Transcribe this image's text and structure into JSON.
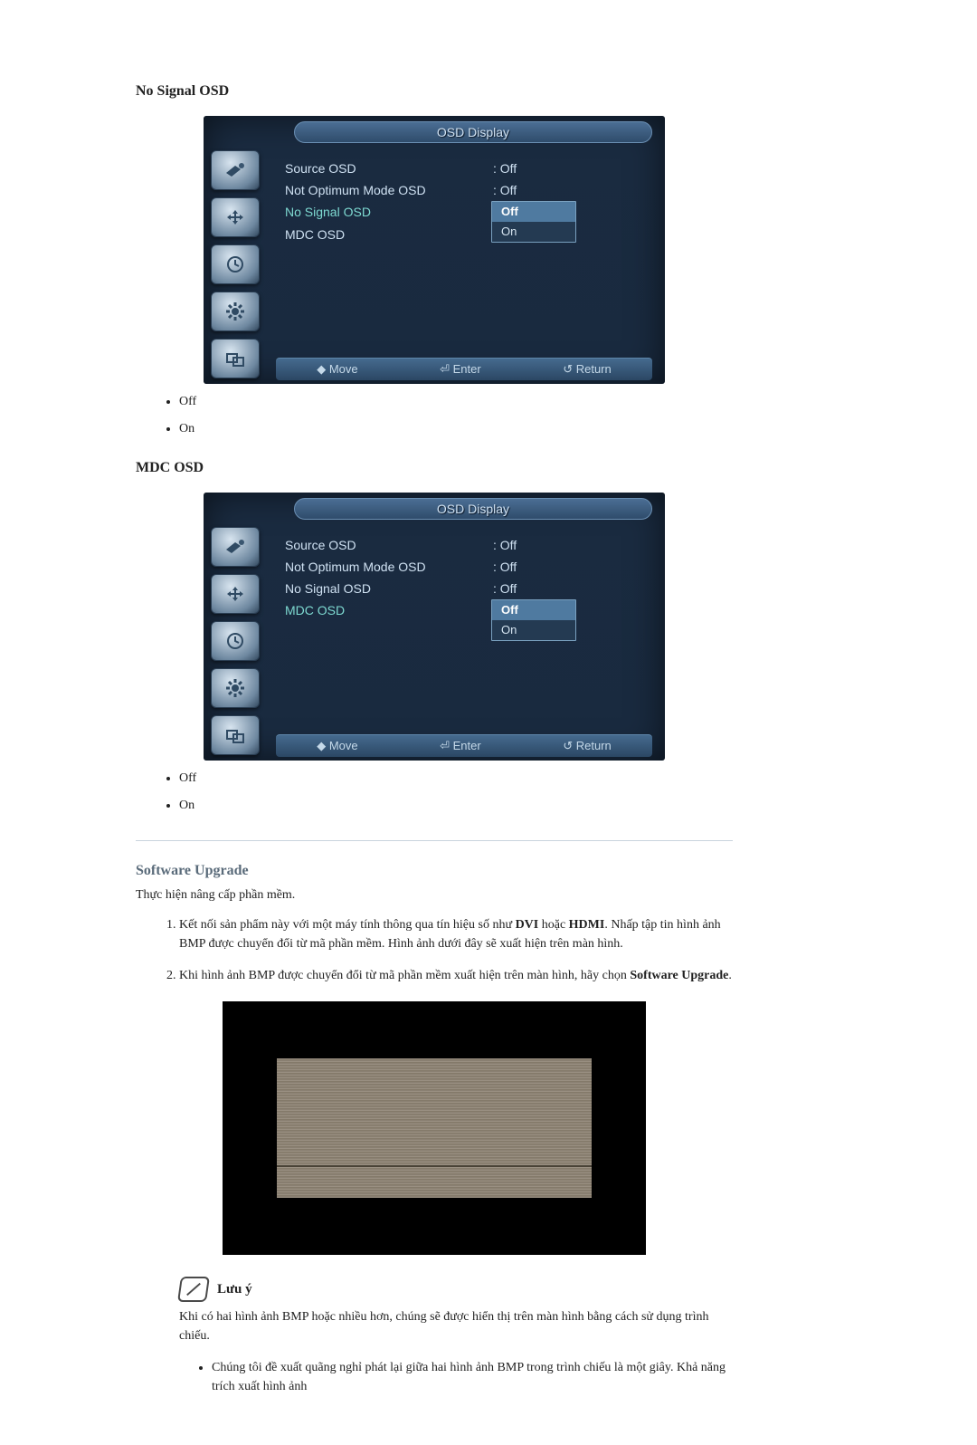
{
  "sections": {
    "noSignal": {
      "title": "No Signal OSD",
      "options": [
        "Off",
        "On"
      ]
    },
    "mdc": {
      "title": "MDC OSD",
      "options": [
        "Off",
        "On"
      ]
    },
    "upgrade": {
      "title": "Software Upgrade",
      "intro": "Thực hiện nâng cấp phần mềm.",
      "step1_pre": "Kết nối sản phẩm này với một máy tính thông qua tín hiệu số như ",
      "step1_b1": "DVI",
      "step1_mid": " hoặc ",
      "step1_b2": "HDMI",
      "step1_post": ". Nhấp tập tin hình ảnh BMP được chuyển đổi từ mã phần mềm. Hình ảnh dưới đây sẽ xuất hiện trên màn hình.",
      "step2_pre": "Khi hình ảnh BMP được chuyển đổi từ mã phần mềm xuất hiện trên màn hình, hãy chọn ",
      "step2_b": "Software Upgrade",
      "step2_post": "."
    },
    "note": {
      "label": "Lưu ý",
      "body": "Khi có hai hình ảnh BMP hoặc nhiều hơn, chúng sẽ được hiển thị trên màn hình bằng cách sử dụng trình chiếu.",
      "bullet": "Chúng tôi đề xuất quãng nghỉ phát lại giữa hai hình ảnh BMP trong trình chiếu là một giây. Khả năng trích xuất hình ảnh"
    }
  },
  "osd": {
    "title": "OSD Display",
    "rows": {
      "source": {
        "label": "Source OSD",
        "value": ": Off"
      },
      "notOptimum": {
        "label": "Not Optimum Mode OSD",
        "value": ": Off"
      },
      "noSignal": {
        "label": "No Signal OSD",
        "value": ": Off"
      },
      "mdc": {
        "label": "MDC OSD",
        "value": ""
      }
    },
    "select": {
      "off": "Off",
      "on": "On"
    },
    "footer": {
      "move": "Move",
      "enter": "Enter",
      "return": "Return"
    }
  }
}
